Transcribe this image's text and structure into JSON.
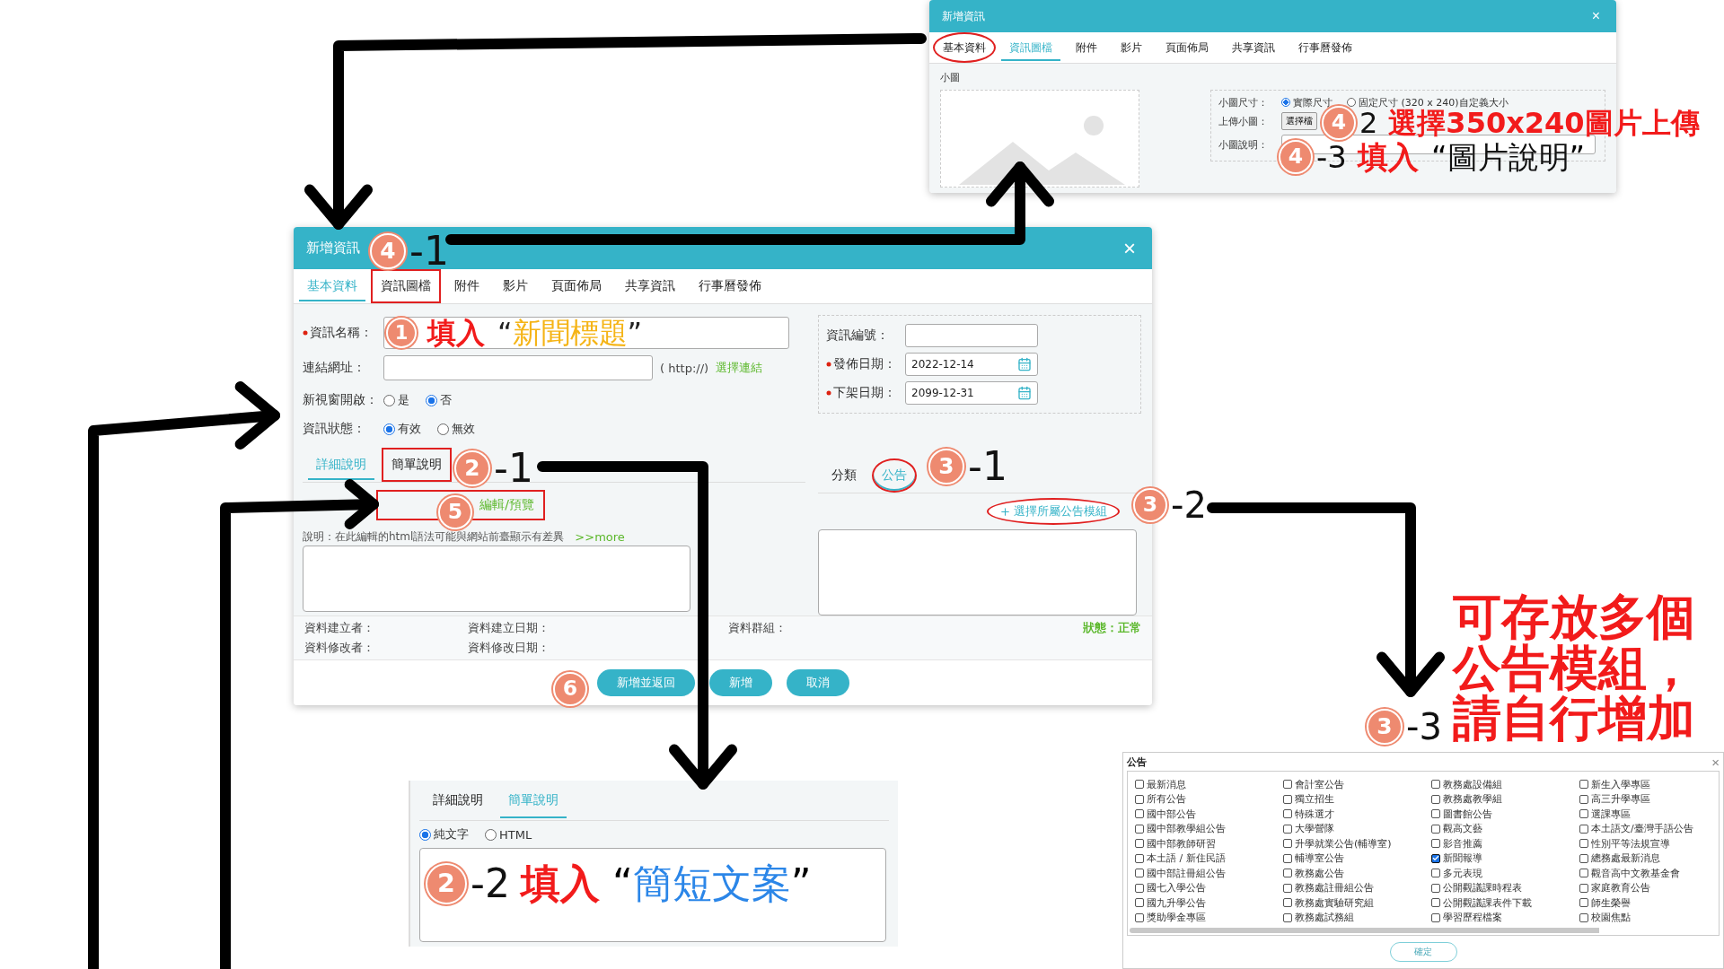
{
  "top_dialog": {
    "title": "新增資訊",
    "close": "×",
    "tabs": [
      {
        "label": "基本資料",
        "selected": false,
        "marked": true
      },
      {
        "label": "資訊圖檔",
        "selected": true,
        "marked": false
      },
      {
        "label": "附件",
        "selected": false,
        "marked": false
      },
      {
        "label": "影片",
        "selected": false,
        "marked": false
      },
      {
        "label": "頁面佈局",
        "selected": false,
        "marked": false
      },
      {
        "label": "共享資訊",
        "selected": false,
        "marked": false
      },
      {
        "label": "行事曆發佈",
        "selected": false,
        "marked": false
      }
    ],
    "section": "小圖",
    "size_group": {
      "label": "小圖尺寸：",
      "options": [
        {
          "label": "實際尺寸",
          "selected": true
        },
        {
          "label": "固定尺寸 (320 x 240)自定義大小",
          "selected": false
        }
      ]
    },
    "upload_label": "上傳小圖：",
    "upload_button": "選擇檔",
    "caption_label": "小圖說明："
  },
  "main_dialog": {
    "title": "新增資訊",
    "close": "×",
    "tabs": [
      {
        "label": "基本資料",
        "selected": true,
        "marked": false
      },
      {
        "label": "資訊圖檔",
        "selected": false,
        "marked": true
      },
      {
        "label": "附件",
        "selected": false,
        "marked": false
      },
      {
        "label": "影片",
        "selected": false,
        "marked": false
      },
      {
        "label": "頁面佈局",
        "selected": false,
        "marked": false
      },
      {
        "label": "共享資訊",
        "selected": false,
        "marked": false
      },
      {
        "label": "行事曆發佈",
        "selected": false,
        "marked": false
      }
    ],
    "name_field": {
      "label": "資訊名稱：",
      "required": true
    },
    "link_field": {
      "label": "連結網址：",
      "hint": "( http://)",
      "link": "選擇連結"
    },
    "radio_groups": [
      {
        "label": "新視窗開啟：",
        "options": [
          {
            "label": "是",
            "selected": false
          },
          {
            "label": "否",
            "selected": true
          }
        ]
      },
      {
        "label": "資訊狀態：",
        "options": [
          {
            "label": "有效",
            "selected": true
          },
          {
            "label": "無效",
            "selected": false
          }
        ]
      }
    ],
    "info_fields": [
      {
        "label": "資訊編號：",
        "required": false,
        "kind": "text"
      },
      {
        "label": "發佈日期：",
        "required": true,
        "kind": "date",
        "value": "2022-12-14"
      },
      {
        "label": "下架日期：",
        "required": true,
        "kind": "date",
        "value": "2099-12-31"
      }
    ],
    "desc_tabs": [
      {
        "label": "詳細說明",
        "selected": true,
        "marked": false
      },
      {
        "label": "簡單說明",
        "selected": false,
        "marked": true
      }
    ],
    "editor_link": "編輯/預覽",
    "note": "說明：在此編輯的html語法可能與網站前臺顯示有差異",
    "more_link": ">>more",
    "category_tabs": [
      {
        "label": "分類",
        "selected": false,
        "marked": false
      },
      {
        "label": "公告",
        "selected": true,
        "marked": true
      }
    ],
    "module_button": {
      "label": "選擇所屬公告模組",
      "marked": true
    },
    "meta_rows": [
      [
        "資料建立者：",
        "資料建立日期：",
        "資料群組："
      ],
      [
        "資料修改者：",
        "資料修改日期："
      ]
    ],
    "status": "狀態：正常",
    "buttons": [
      "新增並返回",
      "新增",
      "取消"
    ]
  },
  "short_desc_panel": {
    "tabs": [
      {
        "label": "詳細說明",
        "selected": false
      },
      {
        "label": "簡單說明",
        "selected": true
      }
    ],
    "options": [
      {
        "label": "純文字",
        "selected": true
      },
      {
        "label": "HTML",
        "selected": false
      }
    ]
  },
  "module_picker": {
    "title": "公告",
    "close": "×",
    "confirm": "確定",
    "columns": [
      {
        "items": [
          {
            "label": "最新消息",
            "checked": false
          },
          {
            "label": "所有公告",
            "checked": false
          },
          {
            "label": "國中部公告",
            "checked": false
          },
          {
            "label": "國中部教學組公告",
            "checked": false
          },
          {
            "label": "國中部教師研習",
            "checked": false
          },
          {
            "label": "本土語 / 新住民語",
            "checked": false
          },
          {
            "label": "國中部註冊組公告",
            "checked": false
          },
          {
            "label": "國七入學公告",
            "checked": false
          },
          {
            "label": "國九升學公告",
            "checked": false
          },
          {
            "label": "獎助學金專區",
            "checked": false
          }
        ]
      },
      {
        "items": [
          {
            "label": "會計室公告",
            "checked": false
          },
          {
            "label": "獨立招生",
            "checked": false
          },
          {
            "label": "特殊選才",
            "checked": false
          },
          {
            "label": "大學營隊",
            "checked": false
          },
          {
            "label": "升學就業公告(輔導室)",
            "checked": false
          },
          {
            "label": "輔導室公告",
            "checked": false
          },
          {
            "label": "教務處公告",
            "checked": false
          },
          {
            "label": "教務處註冊組公告",
            "checked": false
          },
          {
            "label": "教務處實驗研究組",
            "checked": false
          },
          {
            "label": "教務處試務組",
            "checked": false
          }
        ]
      },
      {
        "items": [
          {
            "label": "教務處設備組",
            "checked": false
          },
          {
            "label": "教務處教學組",
            "checked": false
          },
          {
            "label": "圖書館公告",
            "checked": false
          },
          {
            "label": "觀高文藝",
            "checked": false
          },
          {
            "label": "影音推薦",
            "checked": false
          },
          {
            "label": "新聞報導",
            "checked": true
          },
          {
            "label": "多元表現",
            "checked": false
          },
          {
            "label": "公開觀議課時程表",
            "checked": false
          },
          {
            "label": "公開觀議課表件下載",
            "checked": false
          },
          {
            "label": "學習歷程檔案",
            "checked": false
          }
        ]
      },
      {
        "items": [
          {
            "label": "新生入學專區",
            "checked": false
          },
          {
            "label": "高三升學專區",
            "checked": false
          },
          {
            "label": "選課專區",
            "checked": false
          },
          {
            "label": "本土語文/臺灣手語公告",
            "checked": false
          },
          {
            "label": "性別平等法規宣導",
            "checked": false
          },
          {
            "label": "總務處最新消息",
            "checked": false
          },
          {
            "label": "觀音高中文教基金會",
            "checked": false
          },
          {
            "label": "家庭教育公告",
            "checked": false
          },
          {
            "label": "師生榮譽",
            "checked": false
          },
          {
            "label": "校園焦點",
            "checked": false
          }
        ]
      }
    ]
  },
  "annotations": [
    {
      "badge": "4",
      "suffix": "-1"
    },
    {
      "badge": "1",
      "action": "填入",
      "open": "“",
      "quote": "新聞標題",
      "close": "”",
      "color": "#f5b416"
    },
    {
      "badge": "2",
      "suffix": "-1"
    },
    {
      "badge": "5"
    },
    {
      "badge": "3",
      "suffix": "-1"
    },
    {
      "badge": "3",
      "suffix": "-2"
    },
    {
      "badge": "6"
    },
    {
      "badge": "4",
      "suffix": "2",
      "action": "選擇350x240圖片上傳"
    },
    {
      "badge": "4",
      "suffix": "-3",
      "action": "填入",
      "open": "“",
      "quote": "圖片說明",
      "close": "”",
      "color": "#111111"
    },
    {
      "badge": "2",
      "suffix": "-2",
      "action": "填入",
      "open": "“",
      "quote": "簡短文案",
      "close": "”",
      "color": "#2b86e8"
    },
    {
      "badge": "3",
      "suffix": "-3"
    }
  ],
  "callout": "可存放多個公告模組，請自行增加"
}
